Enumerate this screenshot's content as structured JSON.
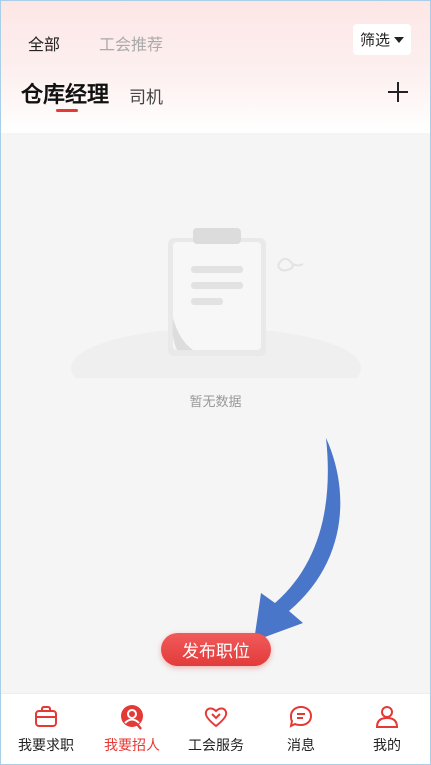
{
  "header": {
    "top_tabs": [
      "全部",
      "工会推荐"
    ],
    "filter_label": "筛选",
    "job_tabs": [
      "仓库经理",
      "司机"
    ]
  },
  "content": {
    "empty_text": "暂无数据",
    "publish_label": "发布职位"
  },
  "tabbar": {
    "items": [
      {
        "label": "我要求职",
        "icon": "briefcase-icon"
      },
      {
        "label": "我要招人",
        "icon": "recruit-icon"
      },
      {
        "label": "工会服务",
        "icon": "heart-icon"
      },
      {
        "label": "消息",
        "icon": "message-icon"
      },
      {
        "label": "我的",
        "icon": "user-icon"
      }
    ],
    "active_index": 1
  },
  "colors": {
    "accent": "#e53935",
    "arrow": "#4a76c9",
    "header_tint": "#fde6e6"
  }
}
